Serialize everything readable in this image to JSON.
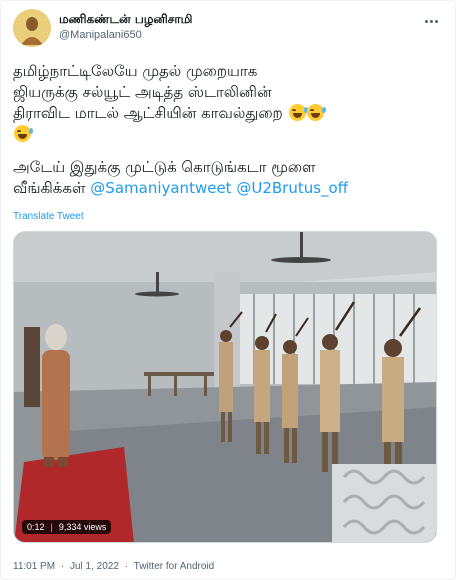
{
  "author": {
    "display_name": "மணிகண்டன் பழனிசாமி",
    "handle": "@Manipalani650"
  },
  "tweet": {
    "line1": "தமிழ்நாட்டிலேயே முதல் முறையாக",
    "line2": "ஜியருக்கு சல்யூட் அடித்த ஸ்டாலினின்",
    "line3": "திராவிட மாடல் ஆட்சியின் காவல்துறை",
    "line4": "அடேய் இதுக்கு முட்டுக் கொடுங்கடா மூளை",
    "line5": "வீங்கிக்கள்",
    "mention1": "@Samaniyantweet",
    "mention2": "@U2Brutus_off",
    "emoji_name": "rolling-on-the-floor-laughing",
    "translate_label": "Translate Tweet"
  },
  "video": {
    "duration": "0:12",
    "views": "9,334 views"
  },
  "meta": {
    "time": "11:01 PM",
    "date": "Jul 1, 2022",
    "source": "Twitter for Android",
    "separator": "·"
  },
  "colors": {
    "link": "#1d9bf0",
    "text": "#0f1419",
    "muted": "#536471"
  }
}
